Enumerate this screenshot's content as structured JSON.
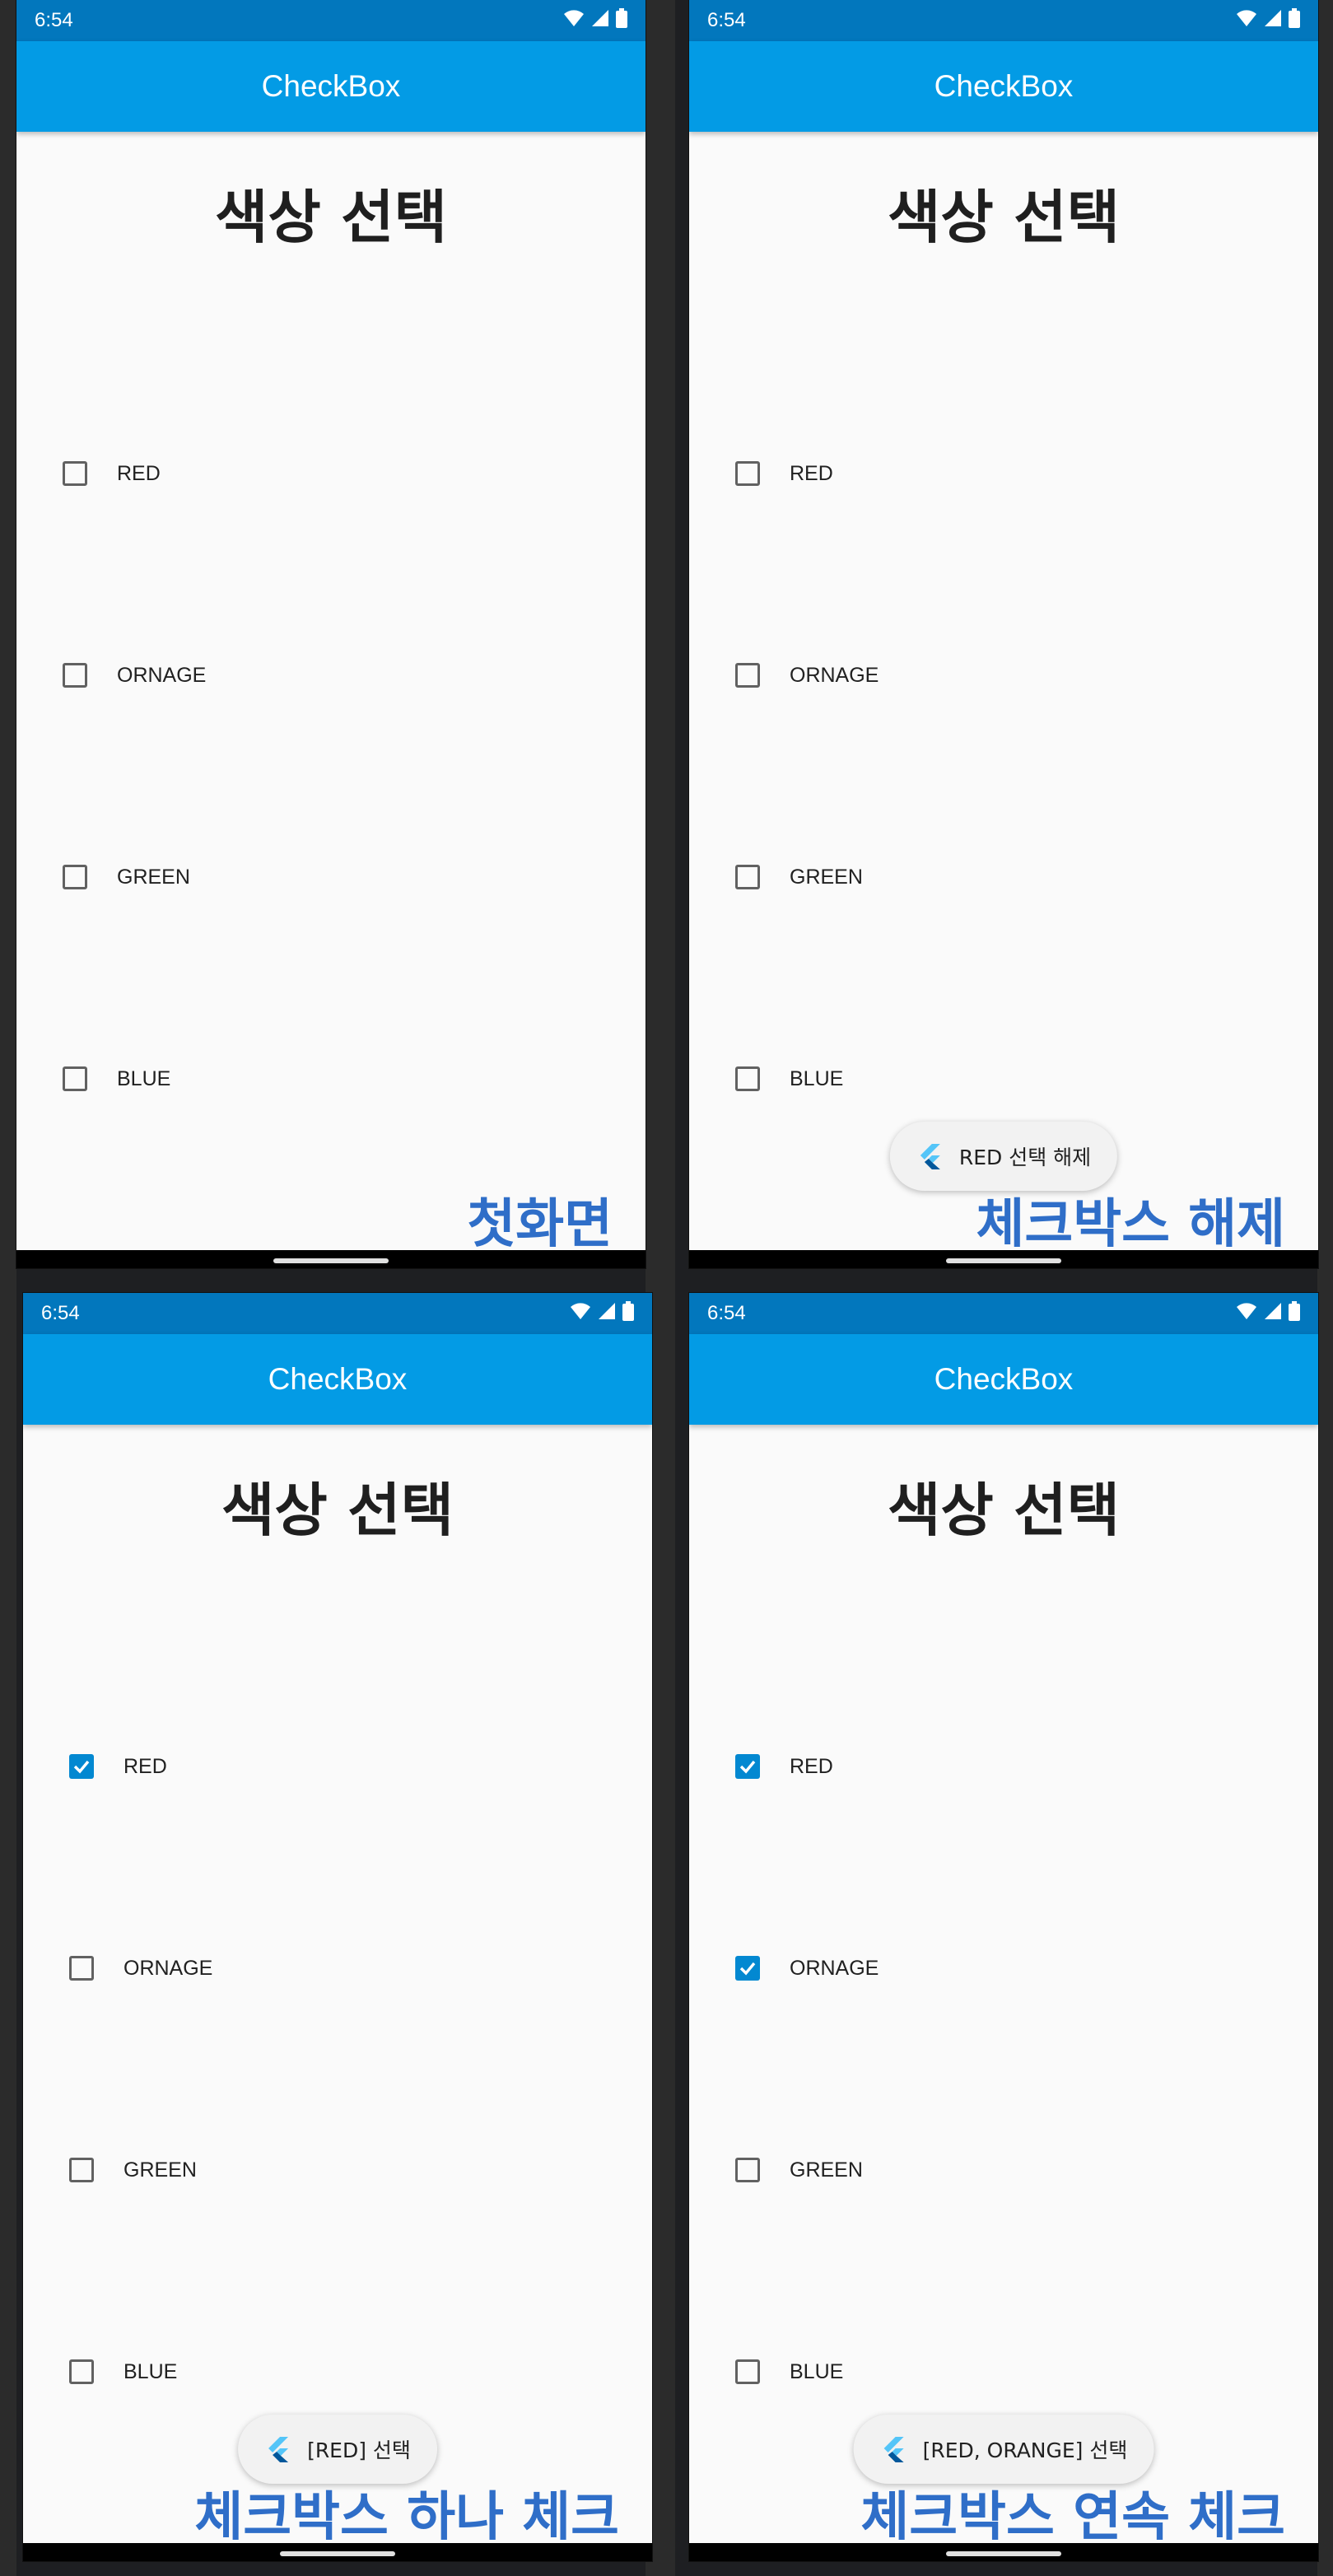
{
  "status_time": "6:54",
  "app_title": "CheckBox",
  "heading": "색상 선택",
  "accent_color": "#0288d1",
  "appbar_color": "#039be5",
  "statusbar_color": "#0277bd",
  "caption_color": "#2f6ec8",
  "icons": {
    "toast": "flutter-logo-icon",
    "wifi": "wifi-icon",
    "signal": "signal-icon",
    "battery": "battery-icon"
  },
  "screens": [
    {
      "caption": "첫화면",
      "toast": "",
      "options": [
        {
          "label": "RED",
          "checked": false
        },
        {
          "label": "ORNAGE",
          "checked": false
        },
        {
          "label": "GREEN",
          "checked": false
        },
        {
          "label": "BLUE",
          "checked": false
        }
      ]
    },
    {
      "caption": "체크박스 해제",
      "toast": "RED 선택 해제",
      "options": [
        {
          "label": "RED",
          "checked": false
        },
        {
          "label": "ORNAGE",
          "checked": false
        },
        {
          "label": "GREEN",
          "checked": false
        },
        {
          "label": "BLUE",
          "checked": false
        }
      ]
    },
    {
      "caption": "체크박스 하나 체크",
      "toast": "[RED] 선택",
      "options": [
        {
          "label": "RED",
          "checked": true
        },
        {
          "label": "ORNAGE",
          "checked": false
        },
        {
          "label": "GREEN",
          "checked": false
        },
        {
          "label": "BLUE",
          "checked": false
        }
      ]
    },
    {
      "caption": "체크박스 연속 체크",
      "toast": "[RED, ORANGE] 선택",
      "options": [
        {
          "label": "RED",
          "checked": true
        },
        {
          "label": "ORNAGE",
          "checked": true
        },
        {
          "label": "GREEN",
          "checked": false
        },
        {
          "label": "BLUE",
          "checked": false
        }
      ]
    }
  ]
}
